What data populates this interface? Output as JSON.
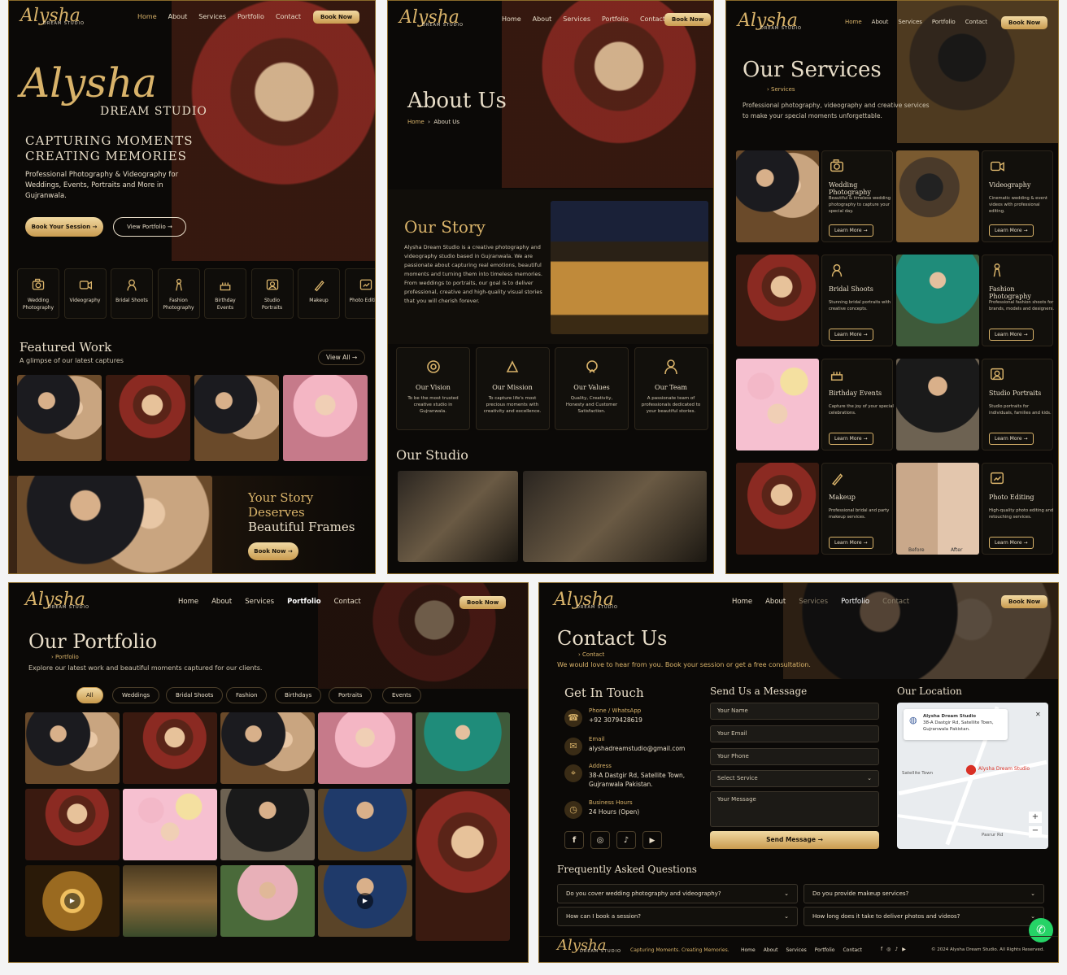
{
  "brand": {
    "script": "Alysha",
    "sub": "DREAM STUDIO"
  },
  "nav": [
    "Home",
    "About",
    "Services",
    "Portfolio",
    "Contact"
  ],
  "book_now": "Book Now",
  "home": {
    "hero_script": "Alysha",
    "hero_sub": "DREAM STUDIO",
    "tag1": "CAPTURING MOMENTS",
    "tag2": "CREATING MEMORIES",
    "desc": "Professional Photography & Videography for Weddings, Events, Portraits and More in Gujranwala.",
    "btn1": "Book Your Session",
    "btn2": "View Portfolio",
    "categories": [
      "Wedding Photography",
      "Videography",
      "Bridal Shoots",
      "Fashion Photography",
      "Birthday Events",
      "Studio Portraits",
      "Makeup",
      "Photo Editing"
    ],
    "featured_title": "Featured Work",
    "featured_sub": "A glimpse of our latest captures",
    "view_all": "View All",
    "banner1": "Your Story",
    "banner2": "Deserves",
    "banner3": "Beautiful Frames",
    "banner_btn": "Book Now"
  },
  "about": {
    "title": "About Us",
    "crumb_home": "Home",
    "crumb_cur": "About Us",
    "story_title": "Our Story",
    "story": "Alysha Dream Studio is a creative photography and videography studio based in Gujranwala. We are passionate about capturing real emotions, beautiful moments and turning them into timeless memories. From weddings to portraits, our goal is to deliver professional, creative and high-quality visual stories that you will cherish forever.",
    "values": [
      {
        "t": "Our Vision",
        "d": "To be the most trusted creative studio in Gujranwala."
      },
      {
        "t": "Our Mission",
        "d": "To capture life's most precious moments with creativity and excellence."
      },
      {
        "t": "Our Values",
        "d": "Quality, Creativity, Honesty and Customer Satisfaction."
      },
      {
        "t": "Our Team",
        "d": "A passionate team of professionals dedicated to your beautiful stories."
      }
    ],
    "studio_title": "Our Studio"
  },
  "services": {
    "title": "Our Services",
    "crumb": "Services",
    "desc1": "Professional photography, videography and creative services",
    "desc2": "to make your special moments unforgettable.",
    "learn": "Learn More",
    "items": [
      {
        "t": "Wedding Photography",
        "d": "Beautiful & timeless wedding photography to capture your special day."
      },
      {
        "t": "Videography",
        "d": "Cinematic wedding & event videos with professional editing."
      },
      {
        "t": "Bridal Shoots",
        "d": "Stunning bridal portraits with creative concepts."
      },
      {
        "t": "Fashion Photography",
        "d": "Professional fashion shoots for brands, models and designers."
      },
      {
        "t": "Birthday Events",
        "d": "Capture the joy of your special celebrations."
      },
      {
        "t": "Studio Portraits",
        "d": "Studio portraits for individuals, families and kids."
      },
      {
        "t": "Makeup",
        "d": "Professional bridal and party makeup services."
      },
      {
        "t": "Photo Editing",
        "d": "High-quality photo editing and retouching services."
      }
    ],
    "before": "Before",
    "after": "After"
  },
  "portfolio": {
    "title": "Our Portfolio",
    "crumb": "Portfolio",
    "desc": "Explore our latest work and beautiful moments captured for our clients.",
    "filters": [
      "All",
      "Weddings",
      "Bridal Shoots",
      "Fashion",
      "Birthdays",
      "Portraits",
      "Events"
    ]
  },
  "contact": {
    "title": "Contact Us",
    "crumb": "Contact",
    "desc": "We would love to hear from you. Book your session or get a free consultation.",
    "git": "Get In Touch",
    "phone_l": "Phone / WhatsApp",
    "phone": "+92 3079428619",
    "email_l": "Email",
    "email": "alyshadreamstudio@gmail.com",
    "addr_l": "Address",
    "addr1": "38-A Dastgir Rd, Satellite Town,",
    "addr2": "Gujranwala Pakistan.",
    "hours_l": "Business Hours",
    "hours": "24 Hours (Open)",
    "msg_title": "Send Us a Message",
    "ph_name": "Your Name",
    "ph_email": "Your Email",
    "ph_phone": "Your Phone",
    "ph_service": "Select Service",
    "ph_msg": "Your Message",
    "send": "Send Message",
    "loc_title": "Our Location",
    "map_name": "Alysha Dream Studio",
    "map_addr1": "38-A Dastgir Rd, Satellite Town,",
    "map_addr2": "Gujranwala Pakistan.",
    "map_pin": "Alysha Dream Studio",
    "map_area": "Satellite Town",
    "map_road": "Pasrur Rd",
    "faq_title": "Frequently Asked Questions",
    "faqs": [
      "Do you cover wedding photography and videography?",
      "Do you provide makeup services?",
      "How can I book a session?",
      "How long does it take to deliver photos and videos?"
    ],
    "footer_tag": "Capturing Moments. Creating Memories.",
    "copy": "© 2024 Alysha Dream Studio. All Rights Reserved."
  }
}
